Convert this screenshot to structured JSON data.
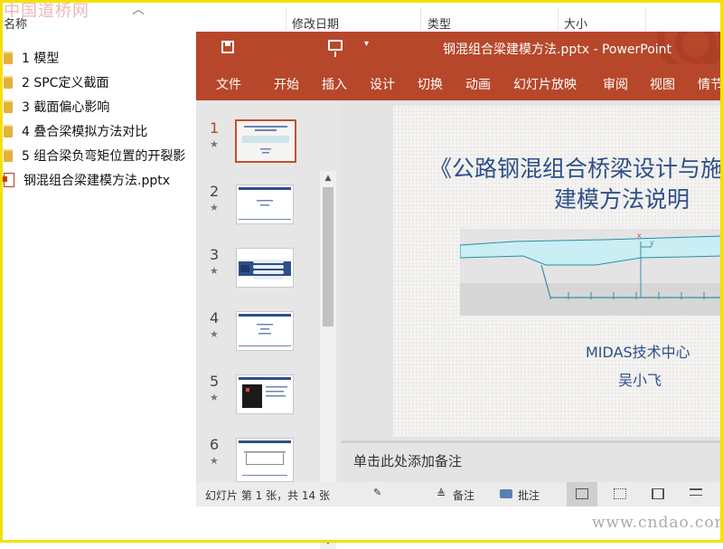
{
  "watermarks": {
    "top": "中国道桥网",
    "bottom": "www.cndao.com"
  },
  "explorer": {
    "columns": {
      "name": "名称",
      "date": "修改日期",
      "type": "类型",
      "size": "大小"
    },
    "items": [
      {
        "icon": "folder-icon",
        "label": "1 模型"
      },
      {
        "icon": "folder-icon",
        "label": "2 SPC定义截面"
      },
      {
        "icon": "folder-icon",
        "label": "3 截面偏心影响"
      },
      {
        "icon": "folder-icon",
        "label": "4 叠合梁模拟方法对比"
      },
      {
        "icon": "folder-icon",
        "label": "5 组合梁负弯矩位置的开裂影"
      },
      {
        "icon": "pptx-file-icon",
        "label": "钢混组合梁建模方法.pptx"
      }
    ]
  },
  "powerpoint": {
    "title": "钢混组合梁建模方法.pptx  -  PowerPoint",
    "accent": "#b7472a",
    "ribbon_tabs": [
      "文件",
      "开始",
      "插入",
      "设计",
      "切换",
      "动画",
      "幻灯片放映",
      "审阅",
      "视图",
      "情节"
    ],
    "thumbnails": [
      {
        "number": "1",
        "star": "★",
        "selected": true
      },
      {
        "number": "2",
        "star": "★",
        "selected": false
      },
      {
        "number": "3",
        "star": "★",
        "selected": false
      },
      {
        "number": "4",
        "star": "★",
        "selected": false
      },
      {
        "number": "5",
        "star": "★",
        "selected": false
      },
      {
        "number": "6",
        "star": "★",
        "selected": false
      }
    ],
    "slide": {
      "title_line1": "《公路钢混组合桥梁设计与施",
      "title_line2": "建模方法说明",
      "org": "MIDAS技术中心",
      "author": "吴小飞",
      "axis_x": "x",
      "axis_y": "y"
    },
    "notes_placeholder": "单击此处添加备注",
    "status": {
      "slide_count": "幻灯片 第 1 张，共 14 张",
      "notes_button": "备注",
      "comments_button": "批注"
    }
  }
}
